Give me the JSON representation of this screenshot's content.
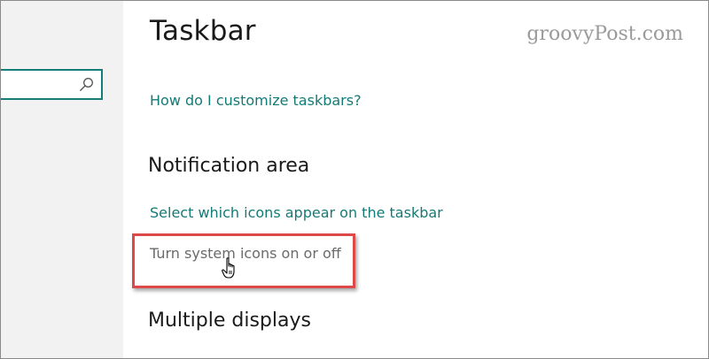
{
  "watermark": "groovyPost.com",
  "search": {
    "value": "",
    "placeholder": ""
  },
  "page": {
    "title": "Taskbar",
    "customize_link": "How do I customize taskbars?"
  },
  "notification_area": {
    "heading": "Notification area",
    "select_icons_link": "Select which icons appear on the taskbar",
    "system_icons_link": "Turn system icons on or off"
  },
  "multiple_displays": {
    "heading": "Multiple displays"
  },
  "icons": {
    "search": "search-icon",
    "cursor": "hand-pointer-icon"
  },
  "colors": {
    "link": "#147a76",
    "search_border": "#167e79",
    "highlight": "#dd4949",
    "sidebar_bg": "#f2f2f2"
  }
}
